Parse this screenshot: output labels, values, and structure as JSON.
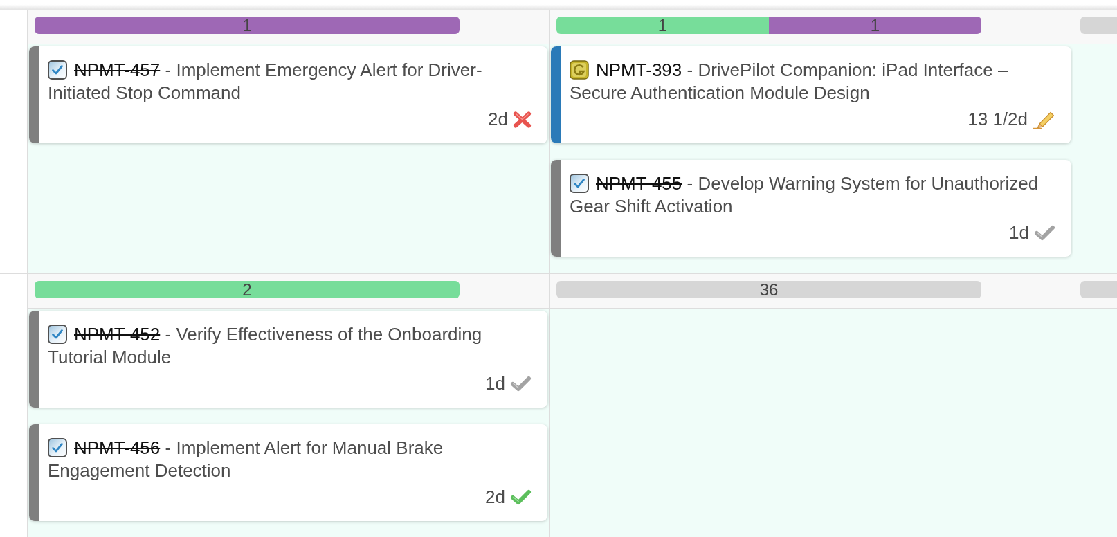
{
  "rows": [
    {
      "cells": [
        {
          "bar": [
            {
              "count": "1",
              "color": "#9e68b5"
            }
          ],
          "cards": [
            {
              "kind": "task",
              "color": "#7f7f7f",
              "id": "NPMT-457",
              "done": true,
              "separator": "-",
              "title": "Implement Emergency Alert for Driver-Initiated Stop Command",
              "estimate": "2d",
              "status": {
                "kind": "rejected"
              }
            }
          ]
        },
        {
          "bar": [
            {
              "count": "1",
              "color": "#77dd9a"
            },
            {
              "count": "1",
              "color": "#9e68b5"
            }
          ],
          "cards": [
            {
              "kind": "story",
              "color": "#2a7ab8",
              "id": "NPMT-393",
              "done": false,
              "separator": "-",
              "title": "DrivePilot Companion: iPad Interface – Secure Authentication Module Design",
              "estimate": "13 1/2d",
              "status": {
                "kind": "in_progress"
              }
            },
            {
              "kind": "task",
              "color": "#7f7f7f",
              "id": "NPMT-455",
              "done": true,
              "separator": "-",
              "title": "Develop Warning System for Unauthorized Gear Shift Activation",
              "estimate": "1d",
              "status": {
                "kind": "completed"
              }
            }
          ]
        },
        {
          "bar": [
            {
              "color": "#d6d6d6"
            }
          ]
        }
      ]
    },
    {
      "cells": [
        {
          "bar": [
            {
              "count": "2",
              "color": "#77dd9a"
            }
          ],
          "cards": [
            {
              "kind": "task",
              "color": "#7f7f7f",
              "id": "NPMT-452",
              "done": true,
              "separator": "-",
              "title": "Verify Effectiveness of the Onboarding Tutorial Module",
              "estimate": "1d",
              "status": {
                "kind": "completed"
              }
            },
            {
              "kind": "task",
              "color": "#7f7f7f",
              "id": "NPMT-456",
              "done": true,
              "separator": "-",
              "title": "Implement Alert for Manual Brake Engagement Detection",
              "estimate": "2d",
              "status": {
                "kind": "accepted"
              }
            }
          ]
        },
        {
          "bar": [
            {
              "count": "36",
              "color": "#d6d6d6"
            }
          ]
        },
        {
          "bar": [
            {
              "color": "#d6d6d6"
            }
          ]
        }
      ]
    }
  ]
}
